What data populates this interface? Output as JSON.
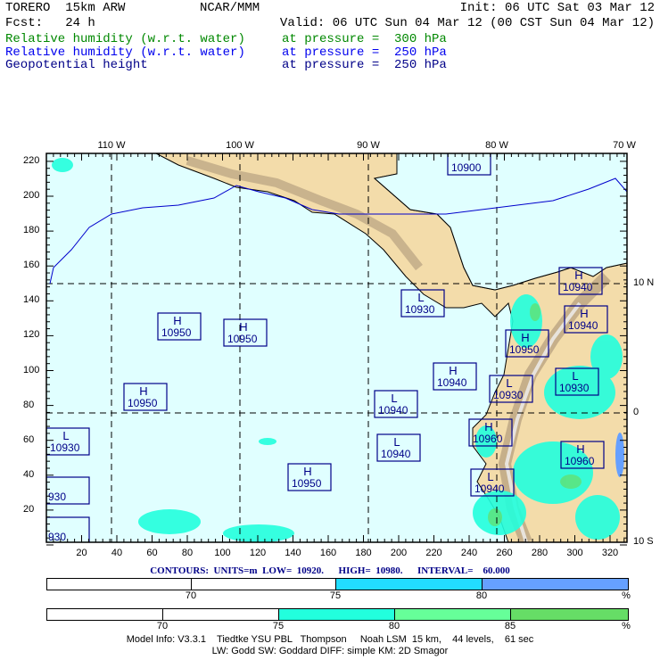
{
  "header": {
    "model": "TORERO  15km ARW",
    "org": "NCAR/MMM",
    "init": "Init: 06 UTC Sat 03 Mar 12",
    "fcst": "Fcst:   24 h",
    "valid": "Valid: 06 UTC Sun 04 Mar 12 (00 CST Sun 04 Mar 12)",
    "fields": [
      {
        "name": "Relative humidity (w.r.t. water)",
        "level": "at pressure =  300 hPa",
        "color": "#008800"
      },
      {
        "name": "Relative humidity (w.r.t. water)",
        "level": "at pressure =  250 hPa",
        "color": "#0000ee"
      },
      {
        "name": "Geopotential height",
        "level": "at pressure =  250 hPa",
        "color": "#000088"
      }
    ]
  },
  "map": {
    "top_lon_labels": [
      "110 W",
      "100 W",
      "90 W",
      "80 W",
      "70 W"
    ],
    "right_lat_labels": [
      "10 N",
      "0",
      "10 S"
    ],
    "left_ticks": [
      "220",
      "200",
      "180",
      "160",
      "140",
      "120",
      "100",
      "80",
      "60",
      "40",
      "20"
    ],
    "bottom_ticks": [
      "20",
      "40",
      "60",
      "80",
      "100",
      "120",
      "140",
      "160",
      "180",
      "200",
      "220",
      "240",
      "260",
      "280",
      "300",
      "320"
    ],
    "centers": [
      {
        "type": "H",
        "value": "10950"
      },
      {
        "type": "H",
        "value": "10950"
      },
      {
        "type": "H",
        "value": "10950"
      },
      {
        "type": "L",
        "value": "10930"
      },
      {
        "type": "",
        "value": "930"
      },
      {
        "type": "",
        "value": "930"
      },
      {
        "type": "H",
        "value": "10950"
      },
      {
        "type": "L",
        "value": "10930"
      },
      {
        "type": "H",
        "value": "10940"
      },
      {
        "type": "L",
        "value": "10940"
      },
      {
        "type": "L",
        "value": "10940"
      },
      {
        "type": "",
        "value": "10900"
      },
      {
        "type": "H",
        "value": "10940"
      },
      {
        "type": "H",
        "value": "10940"
      },
      {
        "type": "H",
        "value": "10950"
      },
      {
        "type": "L",
        "value": "10930"
      },
      {
        "type": "L",
        "value": "10930"
      },
      {
        "type": "H",
        "value": "10960"
      },
      {
        "type": "H",
        "value": "10960"
      },
      {
        "type": "L",
        "value": "10940"
      }
    ],
    "colors": {
      "ocean": "#e0ffff",
      "land": "#f3dcaa",
      "contour": "#0000cc"
    }
  },
  "contours_info": "CONTOURS:  UNITS=m  LOW=  10920.      HIGH=  10980.      INTERVAL=    60.000",
  "colorbar_250": {
    "labels": [
      "70",
      "75",
      "80",
      "%"
    ],
    "colors": [
      "#ffffff",
      "#ffffff",
      "#22ddff",
      "#66a0ff"
    ]
  },
  "colorbar_300": {
    "labels": [
      "70",
      "75",
      "80",
      "85",
      "%"
    ],
    "colors": [
      "#ffffff",
      "#ffffff",
      "#22ffdd",
      "#66ff99",
      "#66dd66"
    ]
  },
  "footer": {
    "line1": "Model Info: V3.3.1    Tiedtke YSU PBL   Thompson     Noah LSM  15 km,    44 levels,    61 sec",
    "line2": "LW: Godd SW: Goddard DIFF: simple KM: 2D Smagor"
  }
}
